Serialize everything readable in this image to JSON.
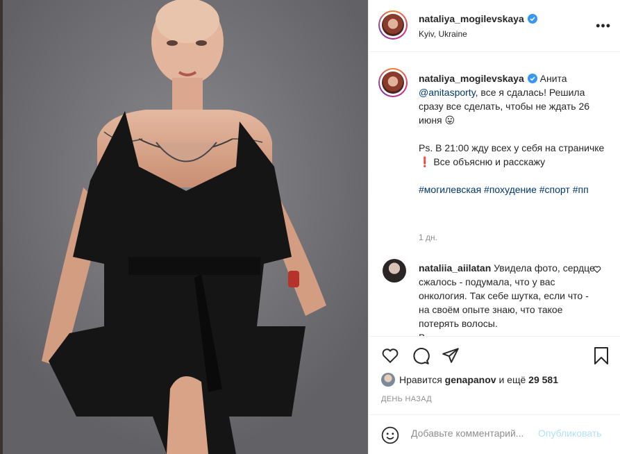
{
  "post": {
    "username": "nataliya_mogilevskaya",
    "location": "Kyiv, Ukraine",
    "more_icon": "more-dots-icon"
  },
  "caption": {
    "username": "nataliya_mogilevskaya",
    "text_1": "Анита",
    "mention": "@anitasporty",
    "text_2": ", все я сдалась! Решила сразу все сделать, чтобы не ждать 26 июня",
    "emoji_1": "😛",
    "text_3": "Ps. В 21:00 жду всех у себя на страничке",
    "emoji_2": "❗",
    "text_4": " Все объясню и расскажу",
    "hashtags": "#могилевская #похудение #спорт #пп",
    "time": "1 дн."
  },
  "comment": {
    "username": "nataliia_aiilatan",
    "text": "Увидела фото, сердце сжалось - подумала, что у вас онкология. Так себе шутка, если что - на своём опыте знаю, что такое потерять волосы.",
    "more": "В..."
  },
  "likes": {
    "prefix": "Нравится ",
    "user": "genapanov",
    "middle": " и ещё ",
    "count": "29 581"
  },
  "timestamp": "ДЕНЬ НАЗАД",
  "add_comment": {
    "placeholder": "Добавьте комментарий...",
    "post_label": "Опубликовать"
  },
  "colors": {
    "link": "#00376b",
    "muted": "#8e8e8e",
    "verified": "#3897f0",
    "post_disabled": "#b2dffc"
  }
}
